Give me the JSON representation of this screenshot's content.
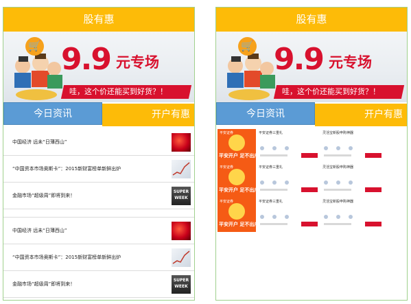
{
  "header": {
    "title": "股有惠"
  },
  "banner": {
    "cart_icon": "cart-icon",
    "price": "9.9",
    "special": "元专场",
    "slogan": "哇，这个价还能买到好货？！"
  },
  "tabs": {
    "news": "今日资讯",
    "account": "开户有惠"
  },
  "news": [
    {
      "title": "中国经济 远未“日薄西山”",
      "thumb": "red-abstract-image"
    },
    {
      "title": "“中国资本市场奥斯卡”：2015新财富榜单新鲜出炉",
      "thumb": "chart-image"
    },
    {
      "title": "金融市场“超级周”即将到来！",
      "thumb": "super-week-image"
    },
    {
      "title": "中国经济 远未“日薄西山”",
      "thumb": "red-abstract-image"
    },
    {
      "title": "“中国资本市场奥斯卡”：2015新财富榜单新鲜出炉",
      "thumb": "chart-image"
    },
    {
      "title": "金融市场“超级周”即将到来！",
      "thumb": "super-week-image"
    }
  ],
  "ads": [
    {
      "brand": "平安证券",
      "slogan": "平安开户 足不出户",
      "card_a": "平安证券三重礼",
      "card_b": "灵活宝新股申购神器"
    },
    {
      "brand": "平安证券",
      "slogan": "平安开户 足不出户",
      "card_a": "平安证券三重礼",
      "card_b": "灵活宝新股申购神器"
    },
    {
      "brand": "平安证券",
      "slogan": "平安开户 足不出户",
      "card_a": "平安证券三重礼",
      "card_b": "灵活宝新股申购神器"
    }
  ],
  "thumb_super_text": "SUPER WEEK",
  "colors": {
    "header": "#fdbb08",
    "tab_active": "#5b9bd5",
    "accent_red": "#d8112e",
    "ad_orange": "#f55b15",
    "phone_border": "#9fd08c"
  }
}
